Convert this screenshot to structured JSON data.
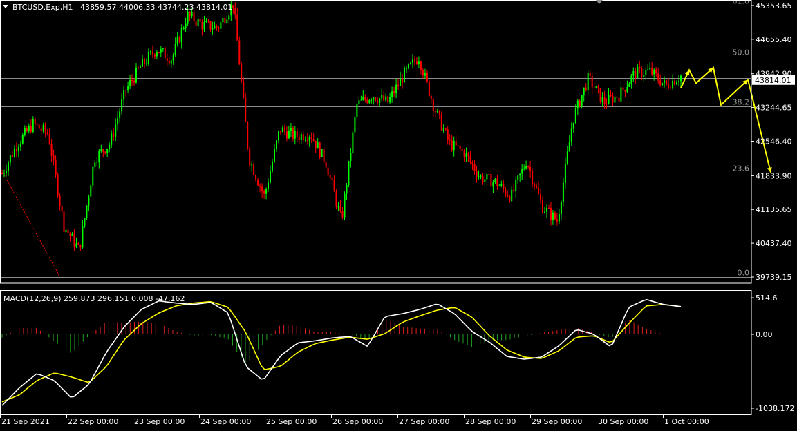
{
  "chart_data": {
    "type": "candlestick",
    "header": {
      "symbol_tf": "BTCUSD.Exp,H1",
      "ohlc": "43859.57 44006.33 43744.23 43814.01"
    },
    "price_axis": {
      "ticks": [
        "45353.65",
        "44655.40",
        "43942.90",
        "43244.65",
        "42546.40",
        "41833.90",
        "41135.65",
        "40437.40",
        "39739.15"
      ],
      "ylim": [
        39739.15,
        45353.65
      ],
      "current_price": "43814.01"
    },
    "fibonacci": [
      {
        "label": "61.8",
        "value": 45353.65
      },
      {
        "label": "50.0",
        "value": 44300
      },
      {
        "label": "38.2",
        "value": 43270
      },
      {
        "label": "23.6",
        "value": 41890
      },
      {
        "label": "0.0",
        "value": 39739
      }
    ],
    "time_axis": [
      "21 Sep 2021",
      "22 Sep 00:00",
      "23 Sep 00:00",
      "24 Sep 00:00",
      "25 Sep 00:00",
      "26 Sep 00:00",
      "27 Sep 00:00",
      "28 Sep 00:00",
      "29 Sep 00:00",
      "30 Sep 00:00",
      "1 Oct 00:00"
    ],
    "price_path": [
      41880,
      42500,
      42900,
      42700,
      40800,
      40300,
      42200,
      42500,
      43600,
      44100,
      44450,
      44250,
      45150,
      44950,
      44900,
      45400,
      42200,
      41400,
      42800,
      42650,
      42700,
      42100,
      40900,
      43300,
      43500,
      43350,
      43900,
      44300,
      43250,
      42500,
      42300,
      41800,
      41700,
      41400,
      42150,
      41200,
      40900,
      43000,
      43850,
      43350,
      43500,
      43950,
      44000,
      43700,
      43900
    ],
    "macd": {
      "title": "MACD(12,26,9) 259.873 296.151 0.008 -47.162",
      "ticks": [
        "514.6",
        "0.00",
        "-1038.172"
      ],
      "ylim": [
        -1038.172,
        514.6
      ],
      "main": [
        -1000,
        -750,
        -550,
        -650,
        -900,
        -700,
        -250,
        100,
        350,
        470,
        440,
        420,
        450,
        300,
        -450,
        -650,
        -300,
        -120,
        -90,
        -50,
        -30,
        -170,
        250,
        290,
        350,
        430,
        290,
        40,
        -110,
        -310,
        -350,
        -320,
        -160,
        70,
        0,
        -180,
        380,
        490,
        420,
        390
      ],
      "signal": [
        -950,
        -850,
        -650,
        -540,
        -600,
        -680,
        -450,
        -80,
        150,
        300,
        400,
        440,
        460,
        380,
        30,
        -500,
        -450,
        -250,
        -130,
        -80,
        -40,
        -70,
        10,
        170,
        260,
        340,
        380,
        240,
        -20,
        -220,
        -320,
        -340,
        -230,
        -40,
        -20,
        -120,
        150,
        400,
        420,
        390
      ]
    },
    "colors": {
      "up": "#00ff00",
      "down": "#ff0000",
      "macd_main": "#ffffff",
      "macd_signal": "#ffff00",
      "fib": "#8c8c8c",
      "arrow": "#ffff00",
      "grid_frame": "#ffffff"
    }
  }
}
